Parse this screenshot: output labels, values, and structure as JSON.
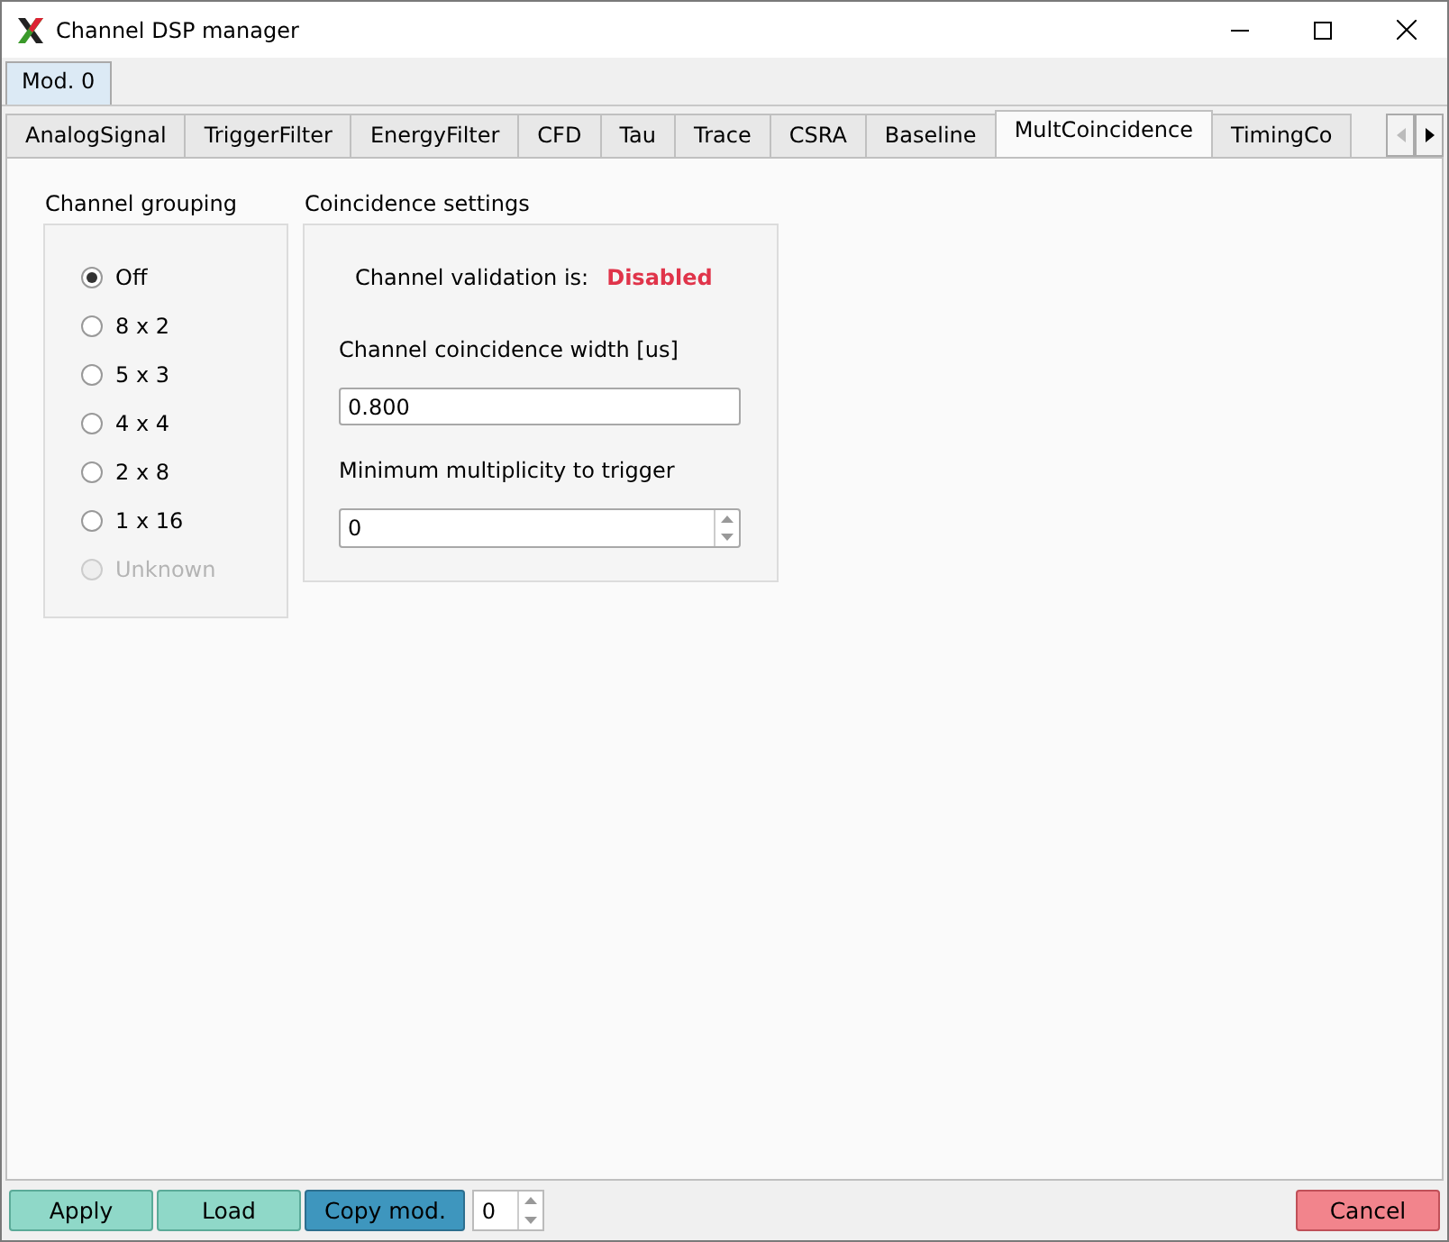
{
  "window": {
    "title": "Channel DSP manager"
  },
  "module_tabs": [
    {
      "label": "Mod. 0",
      "selected": true
    }
  ],
  "tabs": [
    {
      "label": "AnalogSignal",
      "selected": false
    },
    {
      "label": "TriggerFilter",
      "selected": false
    },
    {
      "label": "EnergyFilter",
      "selected": false
    },
    {
      "label": "CFD",
      "selected": false
    },
    {
      "label": "Tau",
      "selected": false
    },
    {
      "label": "Trace",
      "selected": false
    },
    {
      "label": "CSRA",
      "selected": false
    },
    {
      "label": "Baseline",
      "selected": false
    },
    {
      "label": "MultCoincidence",
      "selected": true
    },
    {
      "label": "TimingCo",
      "selected": false
    }
  ],
  "channel_grouping": {
    "title": "Channel grouping",
    "options": [
      {
        "label": "Off",
        "selected": true,
        "disabled": false
      },
      {
        "label": "8 x 2",
        "selected": false,
        "disabled": false
      },
      {
        "label": "5 x 3",
        "selected": false,
        "disabled": false
      },
      {
        "label": "4 x 4",
        "selected": false,
        "disabled": false
      },
      {
        "label": "2 x 8",
        "selected": false,
        "disabled": false
      },
      {
        "label": "1 x 16",
        "selected": false,
        "disabled": false
      },
      {
        "label": "Unknown",
        "selected": false,
        "disabled": true
      }
    ]
  },
  "coincidence_settings": {
    "title": "Coincidence settings",
    "validation_label": "Channel validation is:",
    "validation_status": "Disabled",
    "width_label": "Channel coincidence width [us]",
    "width_value": "0.800",
    "multiplicity_label": "Minimum multiplicity to trigger",
    "multiplicity_value": "0"
  },
  "footer": {
    "buttons": [
      {
        "label": "Apply",
        "kind": "teal"
      },
      {
        "label": "Load",
        "kind": "teal"
      },
      {
        "label": "Copy mod.",
        "kind": "blue"
      }
    ],
    "module_value": "0",
    "cancel": {
      "label": "Cancel",
      "kind": "red"
    }
  }
}
